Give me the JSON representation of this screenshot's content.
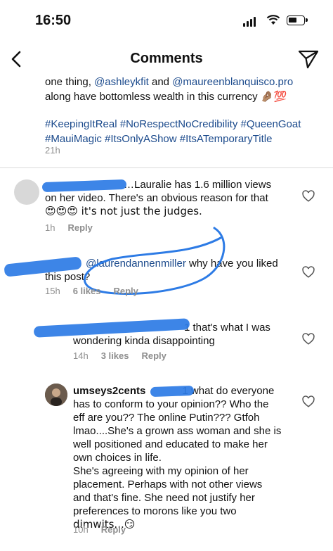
{
  "status_bar": {
    "time": "16:50"
  },
  "nav": {
    "title": "Comments"
  },
  "caption": {
    "line1_prefix": "one thing, ",
    "mention1": "@ashleykfit",
    "and": " and ",
    "mention2": "@maureenblanquisco.pro",
    "line2": "along have bottomless wealth in this currency 🤌🏽💯",
    "hashtags_line1": "#KeepingItReal #NoRespectNoCredibility #QueenGoat",
    "hashtags_line2": "#MauiMagic #ItsOnlyAShow #ItsATemporaryTitle",
    "time": "21h"
  },
  "comments": [
    {
      "text_line1": "…Lauralie has 1.6 million views",
      "text_line2": "on her video. There's an obvious reason for that",
      "text_line3": "😍😍😍 it's not just the judges.",
      "time": "1h",
      "reply": "Reply"
    },
    {
      "mention": "@laurendannenmiller",
      "text_line1_rest": " why have you liked",
      "text_line2": "this post?",
      "time": "15h",
      "likes": "6 likes",
      "reply": "Reply"
    },
    {
      "text_line1": "1 that's what I was",
      "text_line2": "wondering kinda disappointing",
      "time": "14h",
      "likes": "3 likes",
      "reply": "Reply"
    },
    {
      "username": "umseys2cents",
      "text_line1_rest": "1 what do everyone",
      "lines": [
        "has to conform to your opinion?? Who the",
        "eff are you?? The online Putin??? Gtfoh",
        "lmao....She's a grown ass woman and she is",
        "well positioned and educated to make her",
        "own choices in life.",
        "She's agreeing with my opinion of her",
        "placement. Perhaps with not other views",
        "and that's fine. She need not justify her",
        "preferences to morons like you two",
        "dimwits...😏"
      ],
      "time": "10h",
      "reply": "Reply"
    }
  ]
}
